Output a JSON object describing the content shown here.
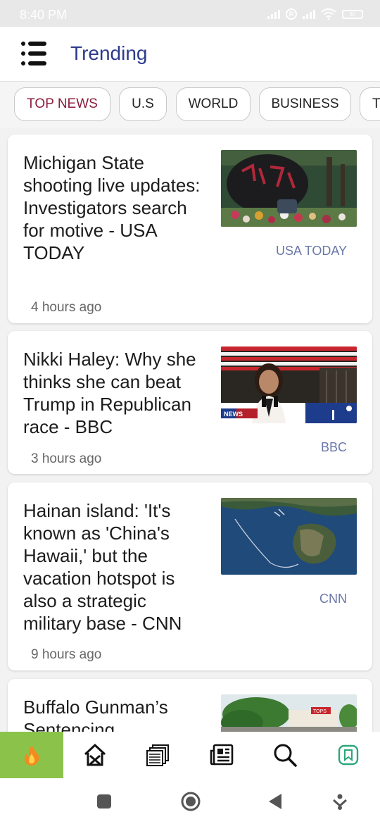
{
  "status_bar": {
    "time": "8:40 PM",
    "battery": "30"
  },
  "header": {
    "title": "Trending"
  },
  "tabs": [
    {
      "label": "TOP NEWS",
      "active": true
    },
    {
      "label": "U.S",
      "active": false
    },
    {
      "label": "WORLD",
      "active": false
    },
    {
      "label": "BUSINESS",
      "active": false
    },
    {
      "label": "T",
      "active": false
    }
  ],
  "articles": [
    {
      "title": "Michigan State shooting live updates: Investigators search for motive - USA TODAY",
      "source": "USA TODAY",
      "time": "4 hours ago"
    },
    {
      "title": "Nikki Haley: Why she thinks she can beat Trump in Republican race - BBC",
      "source": "BBC",
      "time": "3 hours ago",
      "thumb_caption": "NEWS"
    },
    {
      "title": "Hainan island: 'It's known as 'China's Hawaii,' but the vacation hotspot is also a strategic military base - CNN",
      "source": "CNN",
      "time": "9 hours ago"
    },
    {
      "title": "Buffalo Gunman’s Sentencing",
      "source": "",
      "time": "",
      "thumb_caption": "TOPS"
    }
  ],
  "bottom_nav": [
    {
      "icon": "fire-icon",
      "active": true
    },
    {
      "icon": "home-icon",
      "active": false
    },
    {
      "icon": "newspapers-icon",
      "active": false
    },
    {
      "icon": "newspaper-icon",
      "active": false
    },
    {
      "icon": "search-icon",
      "active": false
    },
    {
      "icon": "bookmark-icon",
      "active": false
    }
  ],
  "colors": {
    "accent": "#2d3a8c",
    "active_tab": "#8b1e3f",
    "nav_active": "#8bc34a",
    "source": "#6b78a8"
  }
}
